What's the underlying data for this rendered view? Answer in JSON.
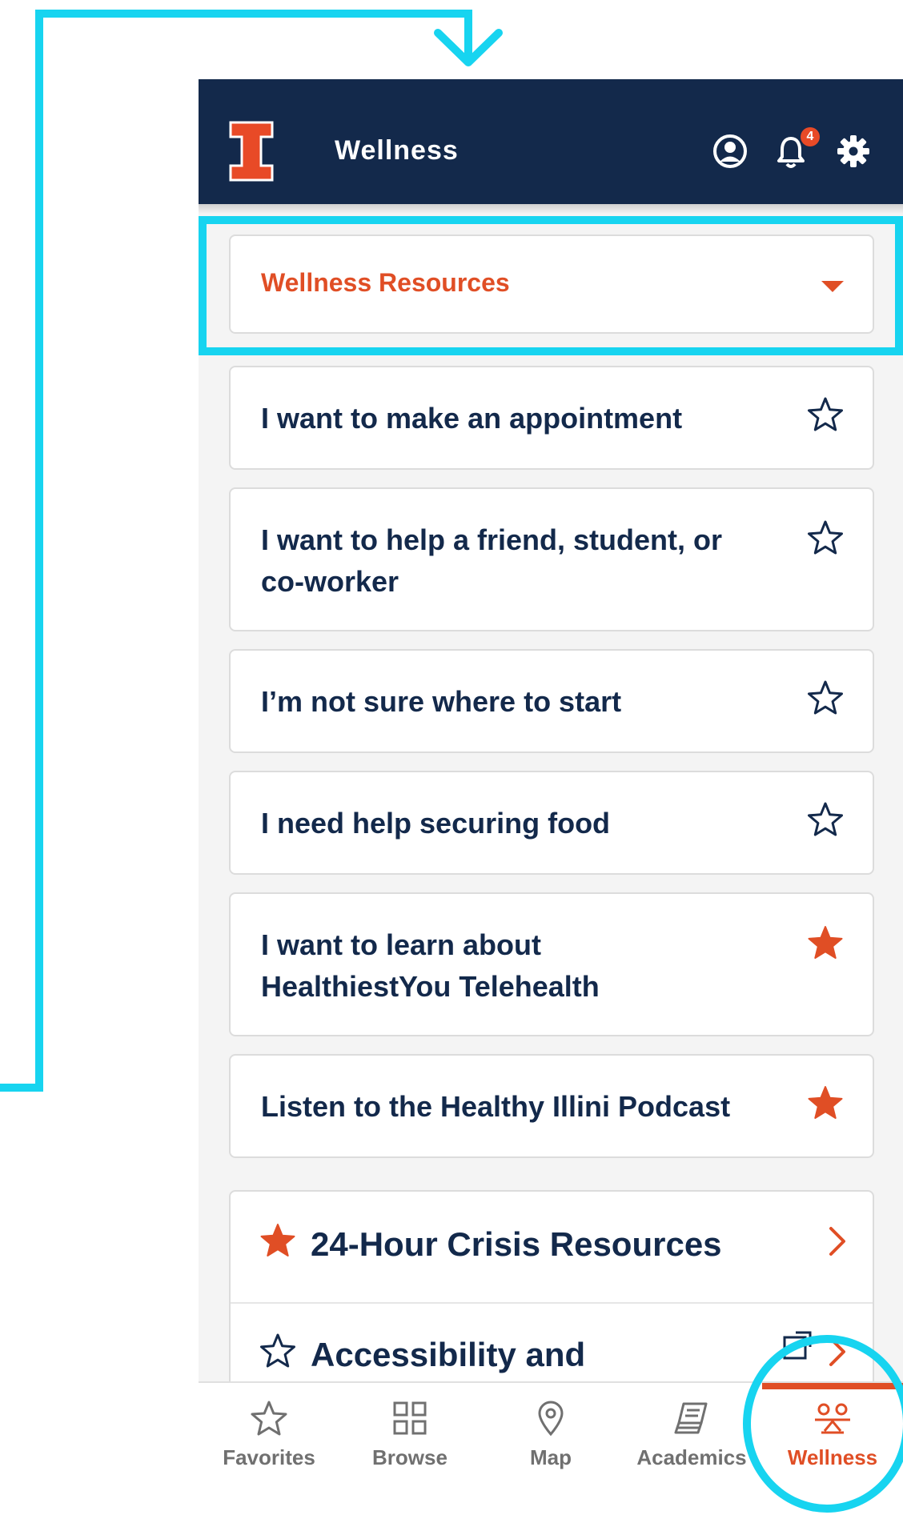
{
  "header": {
    "title": "Wellness",
    "notification_count": "4",
    "icons": [
      "illinois-logo-icon",
      "user-circle-icon",
      "bell-icon",
      "gear-icon"
    ]
  },
  "dropdown": {
    "label": "Wellness Resources",
    "icon": "caret-down-icon"
  },
  "items": [
    {
      "line1": "I want to make an appointment",
      "line2": "",
      "favorited": false
    },
    {
      "line1": "I want to help a friend, student, or",
      "line2": "co-worker",
      "favorited": false
    },
    {
      "line1": "I’m not sure where to start",
      "line2": "",
      "favorited": false
    },
    {
      "line1": "I need help securing food",
      "line2": "",
      "favorited": false
    },
    {
      "line1": "I want to learn about",
      "line2": "HealthiestYou Telehealth",
      "favorited": true
    },
    {
      "line1": "Listen to the Healthy Illini Podcast",
      "line2": "",
      "favorited": true
    }
  ],
  "sections": [
    {
      "label": "24-Hour Crisis Resources",
      "favorited": true
    },
    {
      "label": "Accessibility and",
      "favorited": false
    }
  ],
  "tabs": [
    {
      "label": "Favorites",
      "icon": "star-outline-icon",
      "active": false
    },
    {
      "label": "Browse",
      "icon": "grid-icon",
      "active": false
    },
    {
      "label": "Map",
      "icon": "map-pin-icon",
      "active": false
    },
    {
      "label": "Academics",
      "icon": "books-icon",
      "active": false
    },
    {
      "label": "Wellness",
      "icon": "wellness-icon",
      "active": true
    }
  ],
  "colors": {
    "header_bg": "#13294b",
    "accent": "#e04e25",
    "annotation": "#17d4f0",
    "text_dark": "#13294b"
  }
}
